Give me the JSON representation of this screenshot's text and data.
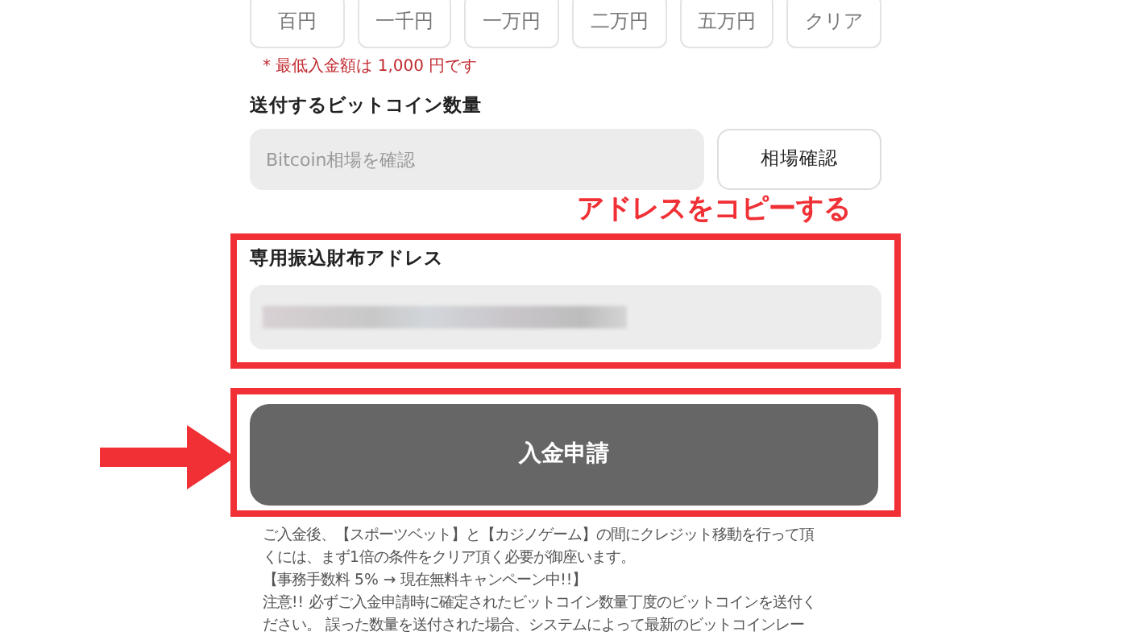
{
  "amount_buttons": [
    "百円",
    "一千円",
    "一万円",
    "二万円",
    "五万円",
    "クリア"
  ],
  "min_note": "* 最低入金額は 1,000 円です",
  "bitcoin": {
    "label": "送付するビットコイン数量",
    "placeholder": "Bitcoin相場を確認",
    "button": "相場確認"
  },
  "annotation": "アドレスをコピーする",
  "address": {
    "label": "専用振込財布アドレス"
  },
  "submit_button": "入金申請",
  "notes": [
    "ご入金後、【スポーツベット】と【カジノゲーム】の間にクレジット移動を行って頂",
    "くには、まず1倍の条件をクリア頂く必要が御座います。",
    "【事務手数料 5% → 現在無料キャンペーン中!!】",
    "注意!! 必ずご入金申請時に確定されたビットコイン数量丁度のビットコインを送付く",
    "ださい。 誤った数量を送付された場合、システムによって最新のビットコインレー"
  ]
}
